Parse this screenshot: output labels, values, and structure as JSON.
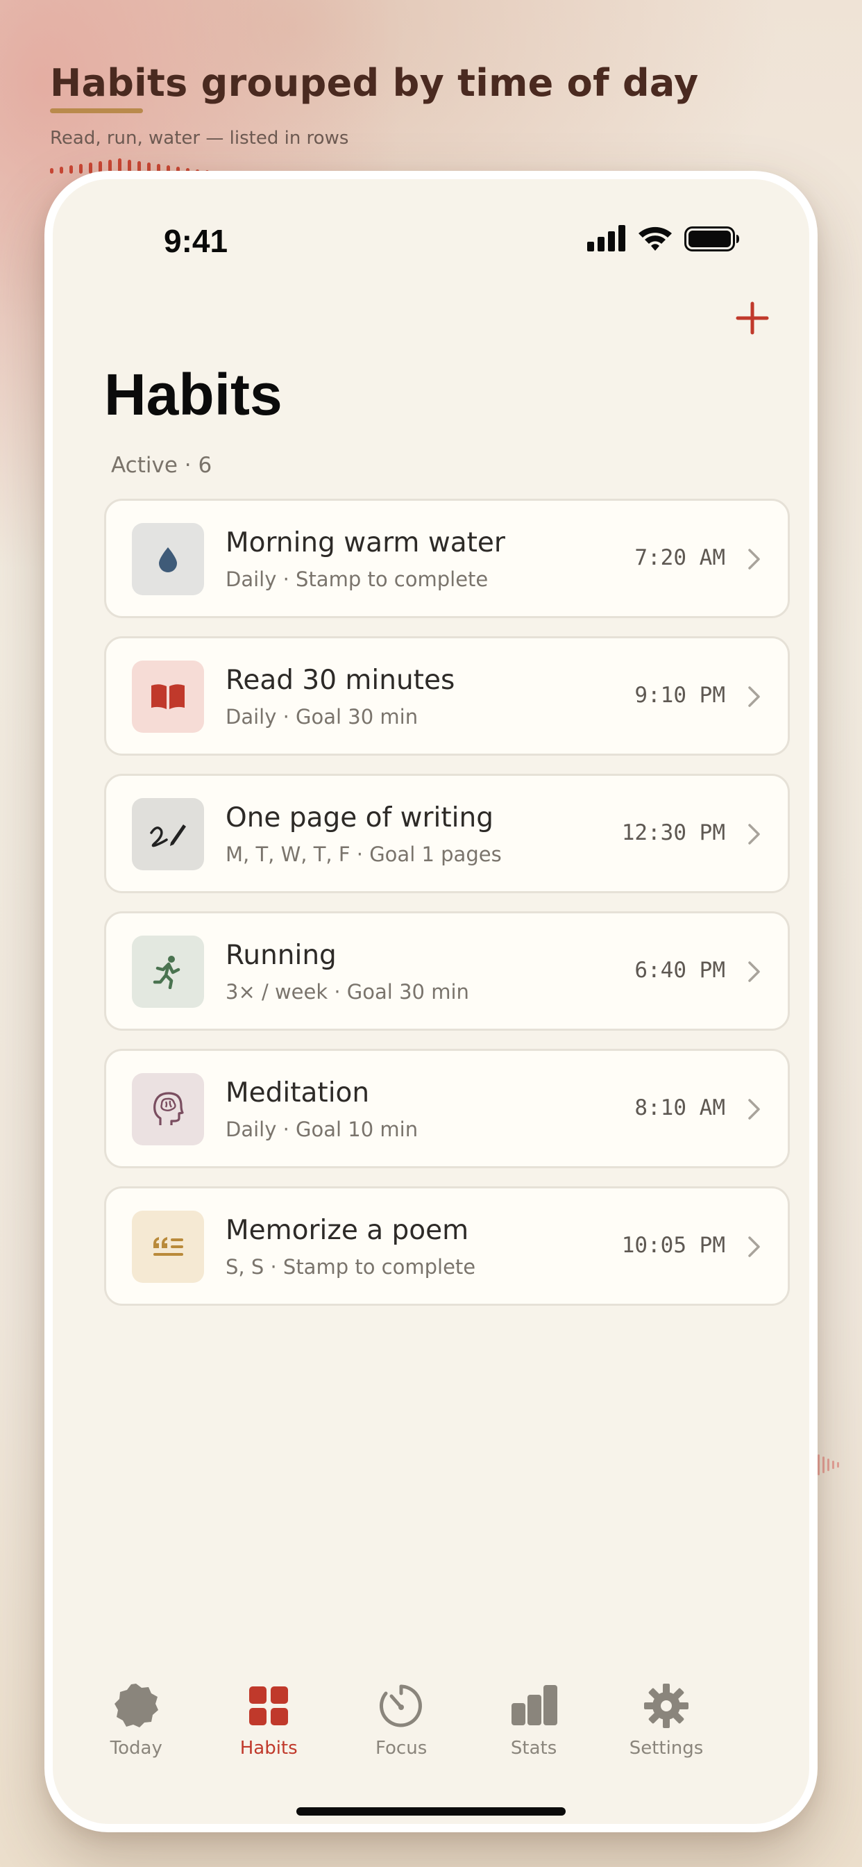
{
  "promo": {
    "title": "Habits grouped by time of day",
    "subtitle": "Read, run, water — listed in rows"
  },
  "status_bar": {
    "time": "9:41"
  },
  "header": {
    "title": "Habits",
    "section_label": "Active · 6",
    "add_icon": "plus-icon"
  },
  "habits": [
    {
      "name": "Morning warm water",
      "meta": "Daily · Stamp to complete",
      "time": "7:20 AM",
      "icon": "water-drop-icon",
      "tile_color": "#e3e3e1",
      "icon_color": "#3f5b78"
    },
    {
      "name": "Read 30 minutes",
      "meta": "Daily · Goal 30 min",
      "time": "9:10 PM",
      "icon": "book-icon",
      "tile_color": "#f6dcd6",
      "icon_color": "#c0392b"
    },
    {
      "name": "One page of writing",
      "meta": "M, T, W, T, F · Goal 1 pages",
      "time": "12:30 PM",
      "icon": "signature-pen-icon",
      "tile_color": "#e0dfdb",
      "icon_color": "#222222"
    },
    {
      "name": "Running",
      "meta": "3× / week · Goal 30 min",
      "time": "6:40 PM",
      "icon": "runner-icon",
      "tile_color": "#e3e8e0",
      "icon_color": "#4a7350"
    },
    {
      "name": "Meditation",
      "meta": "Daily · Goal 10 min",
      "time": "8:10 AM",
      "icon": "head-brain-icon",
      "tile_color": "#ebe1e1",
      "icon_color": "#7a4e60"
    },
    {
      "name": "Memorize a poem",
      "meta": "S, S · Stamp to complete",
      "time": "10:05 PM",
      "icon": "quote-icon",
      "tile_color": "#f5e9d3",
      "icon_color": "#b98a3a"
    }
  ],
  "tabbar": {
    "items": [
      {
        "label": "Today",
        "icon": "badge-icon"
      },
      {
        "label": "Habits",
        "icon": "grid-icon"
      },
      {
        "label": "Focus",
        "icon": "timer-icon"
      },
      {
        "label": "Stats",
        "icon": "bar-chart-icon"
      },
      {
        "label": "Settings",
        "icon": "gear-icon"
      }
    ],
    "active": "Habits"
  },
  "colors": {
    "accent": "#c0392b",
    "background": "#f7f3ea",
    "card": "#fffdf7",
    "inactive_tab": "#8a857c"
  }
}
